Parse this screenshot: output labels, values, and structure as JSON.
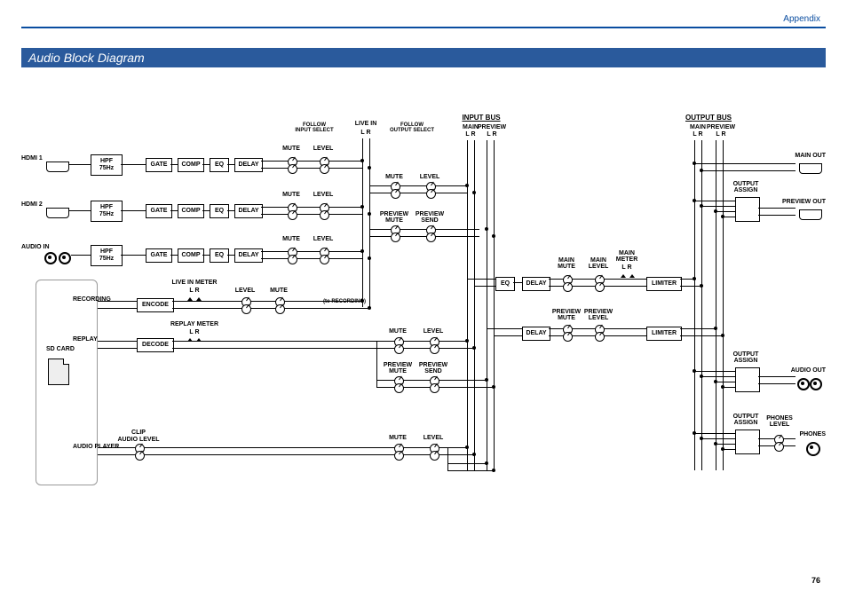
{
  "header": {
    "appendix": "Appendix",
    "title": "Audio Block Diagram",
    "page": "76"
  },
  "inputs": {
    "hdmi1": "HDMI 1",
    "hdmi2": "HDMI 2",
    "audioin": "AUDIO IN",
    "sdcard": "SD CARD",
    "recording": "RECORDING",
    "replay": "REPLAY",
    "audioplayer": "AUDIO PLAYER"
  },
  "blocks": {
    "hpf": "HPF\n75Hz",
    "gate": "GATE",
    "comp": "COMP",
    "eq": "EQ",
    "delay": "DELAY",
    "encode": "ENCODE",
    "decode": "DECODE",
    "limiter": "LIMITER"
  },
  "small": {
    "mute": "MUTE",
    "level": "LEVEL",
    "followinput": "FOLLOW\nINPUT SELECT",
    "followoutput": "FOLLOW\nOUTPUT SELECT",
    "livein": "LIVE IN",
    "lr": "L   R",
    "liveinmeter": "LIVE IN METER",
    "replaymeter": "REPLAY METER",
    "clip": "CLIP",
    "audiolevel": "AUDIO LEVEL",
    "previewmute": "PREVIEW\nMUTE",
    "previewsend": "PREVIEW\nSEND",
    "previewlevel": "PREVIEW\nLEVEL",
    "torecording": "(to RECORDING)"
  },
  "bus": {
    "inputbus": "INPUT BUS",
    "outputbus": "OUTPUT BUS",
    "main": "MAIN",
    "preview": "PREVIEW",
    "mainmute": "MAIN\nMUTE",
    "mainlevel": "MAIN\nLEVEL",
    "mainmeter": "MAIN\nMETER",
    "outputassign": "OUTPUT\nASSIGN",
    "phoneslevel": "PHONES\nLEVEL"
  },
  "outputs": {
    "mainout": "MAIN OUT",
    "previewout": "PREVIEW OUT",
    "audioout": "AUDIO OUT",
    "phones": "PHONES"
  }
}
